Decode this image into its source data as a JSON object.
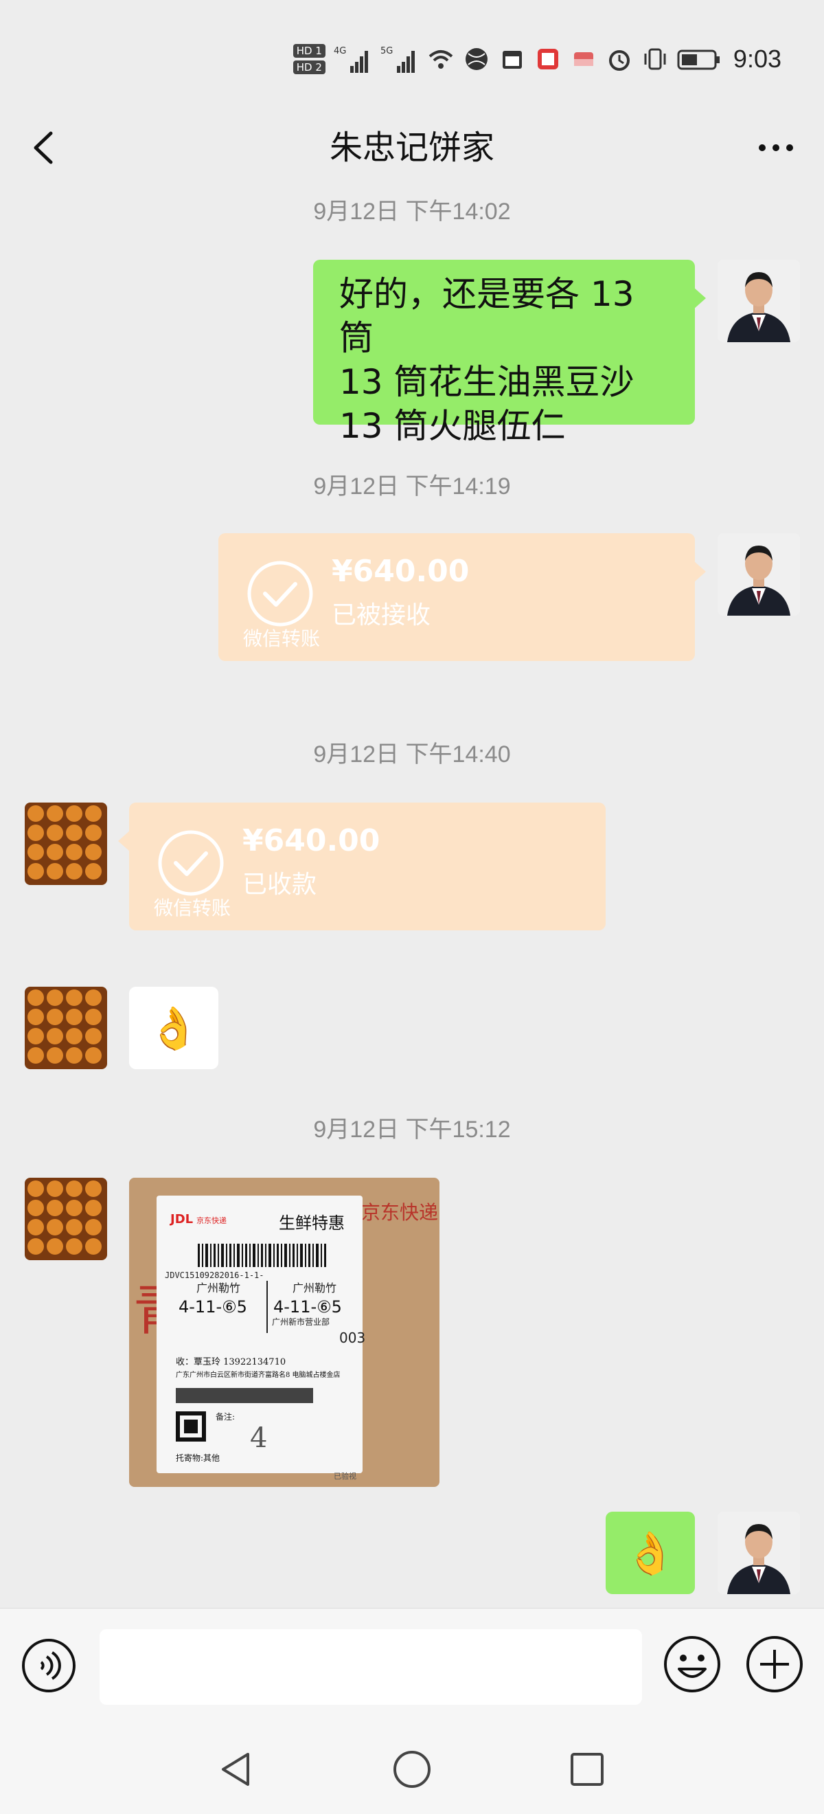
{
  "status_bar": {
    "hd1": "HD 1",
    "hd2": "HD 2",
    "net1": "4G",
    "net2": "5G",
    "time": "9:03"
  },
  "header": {
    "title": "朱忠记饼家"
  },
  "messages": {
    "ts1": "9月12日 下午14:02",
    "text_line1": "好的，还是要各 13 筒",
    "text_line2": "13 筒花生油黑豆沙",
    "text_line3": "13 筒火腿伍仁",
    "ts2": "9月12日 下午14:19",
    "transfer_sent_amount": "¥640.00",
    "transfer_sent_status": "已被接收",
    "transfer_sent_label": "微信转账",
    "ts3": "9月12日 下午14:40",
    "transfer_recv_amount": "¥640.00",
    "transfer_recv_status": "已收款",
    "transfer_recv_label": "微信转账",
    "emoji_ok": "👌",
    "ts4": "9月12日 下午15:12",
    "photo": {
      "logo": "JDL",
      "logo_sub": "京东快递",
      "title": "生鲜特惠",
      "tracking": "JDVC15109282016-1-1-",
      "city1": "广州勒竹",
      "city2": "广州勒竹",
      "code1": "4-11-⑥5",
      "code2": "4-11-⑥5",
      "dept": "广州新市营业部",
      "dept_num": "003",
      "recipient": "收：覃玉玲 13922134710",
      "address": "广东广州市白云区新市街道齐富路名8 电脑城占楼金店",
      "note_label": "备注:",
      "note_value": "4",
      "goods": "托寄物:其他",
      "stamp": "已验视",
      "box_text_left": "青",
      "box_text_right": "京东快递"
    },
    "emoji_ok_sent": "👌"
  },
  "input": {
    "placeholder": ""
  },
  "colors": {
    "bg": "#ededed",
    "green_bubble": "#95ec69",
    "transfer_bubble": "#fde3c7",
    "timestamp": "#8a8a8a"
  }
}
